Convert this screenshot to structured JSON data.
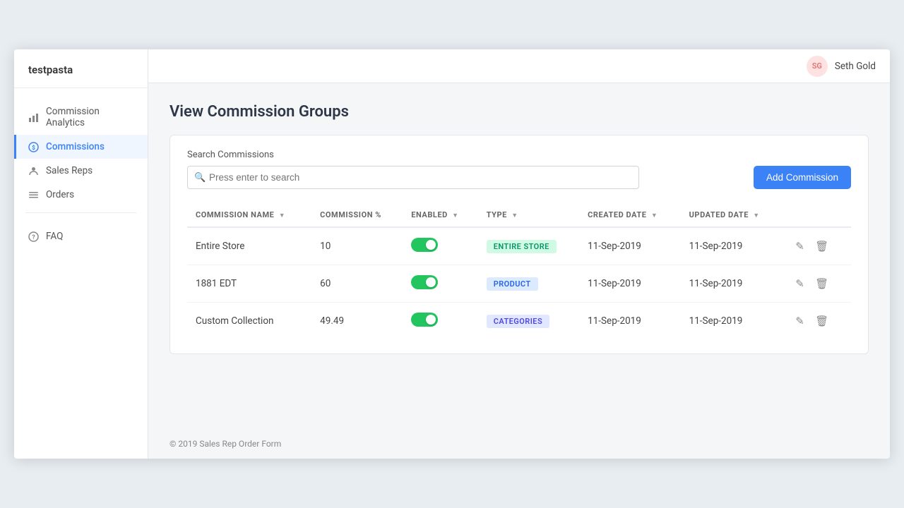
{
  "app": {
    "name": "testpasta"
  },
  "header": {
    "avatar": "SG",
    "username": "Seth Gold"
  },
  "sidebar": {
    "items": [
      {
        "id": "analytics",
        "label": "Commission Analytics",
        "icon": "chart-icon",
        "active": false
      },
      {
        "id": "commissions",
        "label": "Commissions",
        "icon": "dollar-icon",
        "active": true
      },
      {
        "id": "sales-reps",
        "label": "Sales Reps",
        "icon": "person-icon",
        "active": false
      },
      {
        "id": "orders",
        "label": "Orders",
        "icon": "list-icon",
        "active": false
      }
    ],
    "faq": {
      "label": "FAQ",
      "icon": "help-icon"
    }
  },
  "page": {
    "title": "View Commission Groups"
  },
  "search": {
    "label": "Search Commissions",
    "placeholder": "Press enter to search",
    "value": ""
  },
  "add_button": "Add Commission",
  "table": {
    "columns": [
      {
        "key": "name",
        "label": "COMMISSION NAME",
        "sortable": true
      },
      {
        "key": "percent",
        "label": "COMMISSION %",
        "sortable": false
      },
      {
        "key": "enabled",
        "label": "ENABLED",
        "sortable": true
      },
      {
        "key": "type",
        "label": "TYPE",
        "sortable": true
      },
      {
        "key": "created",
        "label": "CREATED DATE",
        "sortable": true
      },
      {
        "key": "updated",
        "label": "UPDATED DATE",
        "sortable": true
      }
    ],
    "rows": [
      {
        "name": "Entire Store",
        "percent": "10",
        "enabled": true,
        "type": "ENTIRE STORE",
        "type_key": "store",
        "created": "11-Sep-2019",
        "updated": "11-Sep-2019"
      },
      {
        "name": "1881 EDT",
        "percent": "60",
        "enabled": true,
        "type": "PRODUCT",
        "type_key": "product",
        "created": "11-Sep-2019",
        "updated": "11-Sep-2019"
      },
      {
        "name": "Custom Collection",
        "percent": "49.49",
        "enabled": true,
        "type": "CATEGORIES",
        "type_key": "categories",
        "created": "11-Sep-2019",
        "updated": "11-Sep-2019"
      }
    ]
  },
  "footer": {
    "text": "© 2019 Sales Rep Order Form"
  }
}
